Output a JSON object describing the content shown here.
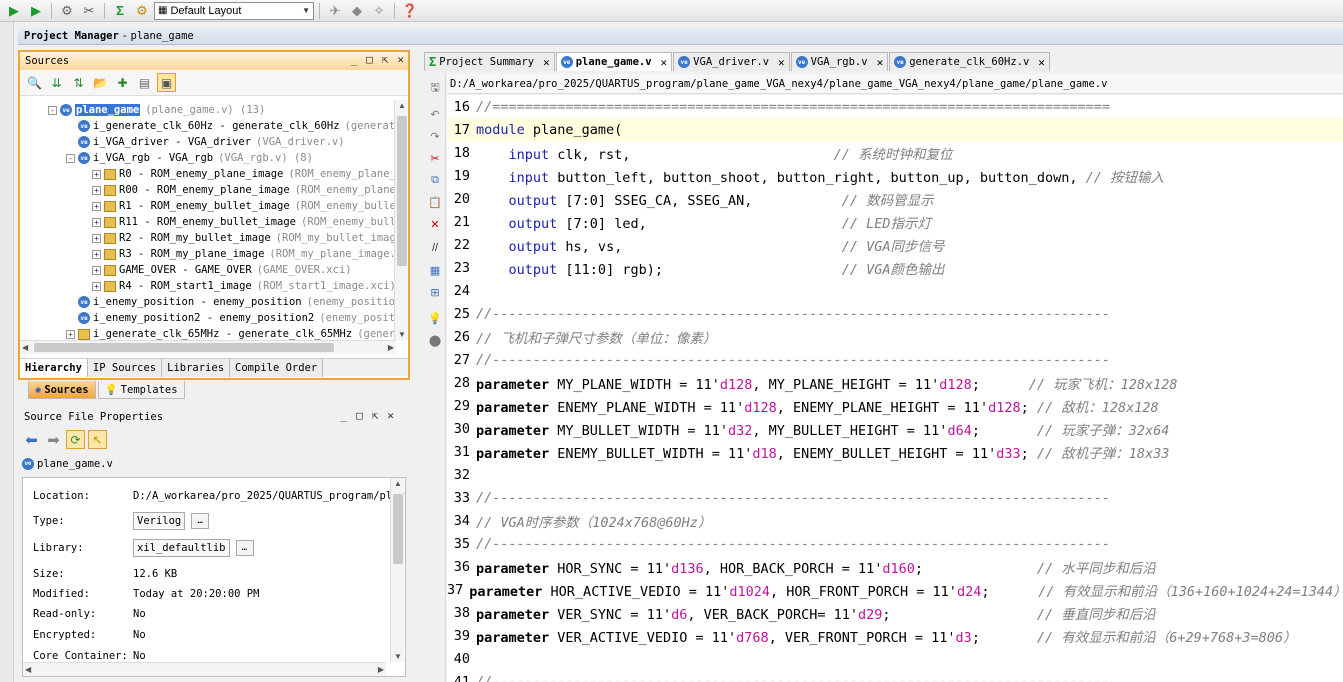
{
  "toolbar": {
    "layout_value": "Default Layout"
  },
  "project_manager": {
    "title": "Project Manager",
    "project": "plane_game"
  },
  "sources": {
    "title": "Sources",
    "tree": [
      {
        "label": "plane_game",
        "sub": "(plane_game.v) (13)",
        "icon": "verilog",
        "selected": true
      },
      {
        "label": "i_generate_clk_60Hz - generate_clk_60Hz",
        "sub": "(generate",
        "icon": "verilog"
      },
      {
        "label": "i_VGA_driver - VGA_driver",
        "sub": "(VGA_driver.v)",
        "icon": "verilog"
      },
      {
        "label": "i_VGA_rgb - VGA_rgb",
        "sub": "(VGA_rgb.v) (8)",
        "icon": "verilog"
      },
      {
        "label": "R0 - ROM_enemy_plane_image",
        "sub": "(ROM_enemy_plane_",
        "icon": "ip"
      },
      {
        "label": "R00 - ROM_enemy_plane_image",
        "sub": "(ROM_enemy_plane",
        "icon": "ip"
      },
      {
        "label": "R1 - ROM_enemy_bullet_image",
        "sub": "(ROM_enemy_bulle",
        "icon": "ip"
      },
      {
        "label": "R11 - ROM_enemy_bullet_image",
        "sub": "(ROM_enemy_bull",
        "icon": "ip"
      },
      {
        "label": "R2 - ROM_my_bullet_image",
        "sub": "(ROM_my_bullet_imag",
        "icon": "ip"
      },
      {
        "label": "R3 - ROM_my_plane_image",
        "sub": "(ROM_my_plane_image.:",
        "icon": "ip"
      },
      {
        "label": "GAME_OVER - GAME_OVER",
        "sub": "(GAME_OVER.xci)",
        "icon": "ip"
      },
      {
        "label": "R4 - ROM_start1_image",
        "sub": "(ROM_start1_image.xci)",
        "icon": "ip"
      },
      {
        "label": "i_enemy_position - enemy_position",
        "sub": "(enemy_position",
        "icon": "verilog"
      },
      {
        "label": "i_enemy_position2 - enemy_position2",
        "sub": "(enemy_positi",
        "icon": "verilog"
      },
      {
        "label": "i_generate_clk_65MHz - generate_clk_65MHz",
        "sub": "(gener",
        "icon": "ip"
      }
    ],
    "tabs": [
      "Hierarchy",
      "IP Sources",
      "Libraries",
      "Compile Order"
    ]
  },
  "bottom_tabs": [
    "Sources",
    "Templates"
  ],
  "sfp": {
    "title": "Source File Properties",
    "file": "plane_game.v",
    "props": [
      {
        "label": "Location:",
        "value": "D:/A_workarea/pro_2025/QUARTUS_program/plar"
      },
      {
        "label": "Type:",
        "value": "Verilog"
      },
      {
        "label": "Library:",
        "value": "xil_defaultlib"
      },
      {
        "label": "Size:",
        "value": "12.6 KB"
      },
      {
        "label": "Modified:",
        "value": "Today at 20:20:00 PM"
      },
      {
        "label": "Read-only:",
        "value": "No"
      },
      {
        "label": "Encrypted:",
        "value": "No"
      },
      {
        "label": "Core Container:",
        "value": "No"
      }
    ]
  },
  "editor": {
    "tabs": [
      {
        "label": "Project Summary",
        "icon": "sigma"
      },
      {
        "label": "plane_game.v",
        "icon": "verilog",
        "active": true
      },
      {
        "label": "VGA_driver.v",
        "icon": "verilog"
      },
      {
        "label": "VGA_rgb.v",
        "icon": "verilog"
      },
      {
        "label": "generate_clk_60Hz.v",
        "icon": "verilog"
      }
    ],
    "path": "D:/A_workarea/pro_2025/QUARTUS_program/plane_game_VGA_nexy4/plane_game_VGA_nexy4/plane_game/plane_game.v",
    "lines": [
      {
        "n": "16",
        "tokens": [
          [
            "cm",
            "//============================================================================"
          ]
        ]
      },
      {
        "n": "17",
        "cur": true,
        "tokens": [
          [
            "kw2",
            "module"
          ],
          [
            "t",
            " plane_game("
          ]
        ]
      },
      {
        "n": "18",
        "tokens": [
          [
            "t",
            "    "
          ],
          [
            "kw2",
            "input"
          ],
          [
            "t",
            " clk, rst,                         "
          ],
          [
            "cm",
            "// 系统时钟和复位"
          ]
        ]
      },
      {
        "n": "19",
        "tokens": [
          [
            "t",
            "    "
          ],
          [
            "kw2",
            "input"
          ],
          [
            "t",
            " button_left, button_shoot, button_right, button_up, button_down, "
          ],
          [
            "cm",
            "// 按钮输入"
          ]
        ]
      },
      {
        "n": "20",
        "tokens": [
          [
            "t",
            "    "
          ],
          [
            "kw2",
            "output"
          ],
          [
            "t",
            " [7:0] SSEG_CA, SSEG_AN,           "
          ],
          [
            "cm",
            "// 数码管显示"
          ]
        ]
      },
      {
        "n": "21",
        "tokens": [
          [
            "t",
            "    "
          ],
          [
            "kw2",
            "output"
          ],
          [
            "t",
            " [7:0] led,                        "
          ],
          [
            "cm",
            "// LED指示灯"
          ]
        ]
      },
      {
        "n": "22",
        "tokens": [
          [
            "t",
            "    "
          ],
          [
            "kw2",
            "output"
          ],
          [
            "t",
            " hs, vs,                           "
          ],
          [
            "cm",
            "// VGA同步信号"
          ]
        ]
      },
      {
        "n": "23",
        "tokens": [
          [
            "t",
            "    "
          ],
          [
            "kw2",
            "output"
          ],
          [
            "t",
            " [11:0] rgb);                      "
          ],
          [
            "cm",
            "// VGA颜色输出"
          ]
        ]
      },
      {
        "n": "24",
        "tokens": []
      },
      {
        "n": "25",
        "tokens": [
          [
            "cm",
            "//----------------------------------------------------------------------------"
          ]
        ]
      },
      {
        "n": "26",
        "tokens": [
          [
            "cm",
            "// 飞机和子弹尺寸参数（单位：像素）"
          ]
        ]
      },
      {
        "n": "27",
        "tokens": [
          [
            "cm",
            "//----------------------------------------------------------------------------"
          ]
        ]
      },
      {
        "n": "28",
        "tokens": [
          [
            "kw",
            "parameter"
          ],
          [
            "t",
            " MY_PLANE_WIDTH = 11'"
          ],
          [
            "num",
            "d128"
          ],
          [
            "t",
            ", MY_PLANE_HEIGHT = 11'"
          ],
          [
            "num",
            "d128"
          ],
          [
            "t",
            ";      "
          ],
          [
            "cm",
            "// 玩家飞机：128x128"
          ]
        ]
      },
      {
        "n": "29",
        "tokens": [
          [
            "kw",
            "parameter"
          ],
          [
            "t",
            " ENEMY_PLANE_WIDTH = 11'"
          ],
          [
            "num",
            "d128"
          ],
          [
            "t",
            ", ENEMY_PLANE_HEIGHT = 11'"
          ],
          [
            "num",
            "d128"
          ],
          [
            "t",
            "; "
          ],
          [
            "cm",
            "// 敌机：128x128"
          ]
        ]
      },
      {
        "n": "30",
        "tokens": [
          [
            "kw",
            "parameter"
          ],
          [
            "t",
            " MY_BULLET_WIDTH = 11'"
          ],
          [
            "num",
            "d32"
          ],
          [
            "t",
            ", MY_BULLET_HEIGHT = 11'"
          ],
          [
            "num",
            "d64"
          ],
          [
            "t",
            ";       "
          ],
          [
            "cm",
            "// 玩家子弹：32x64"
          ]
        ]
      },
      {
        "n": "31",
        "tokens": [
          [
            "kw",
            "parameter"
          ],
          [
            "t",
            " ENEMY_BULLET_WIDTH = 11'"
          ],
          [
            "num",
            "d18"
          ],
          [
            "t",
            ", ENEMY_BULLET_HEIGHT = 11'"
          ],
          [
            "num",
            "d33"
          ],
          [
            "t",
            "; "
          ],
          [
            "cm",
            "// 敌机子弹：18x33"
          ]
        ]
      },
      {
        "n": "32",
        "tokens": []
      },
      {
        "n": "33",
        "tokens": [
          [
            "cm",
            "//----------------------------------------------------------------------------"
          ]
        ]
      },
      {
        "n": "34",
        "tokens": [
          [
            "cm",
            "// VGA时序参数（1024x768@60Hz）"
          ]
        ]
      },
      {
        "n": "35",
        "tokens": [
          [
            "cm",
            "//----------------------------------------------------------------------------"
          ]
        ]
      },
      {
        "n": "36",
        "tokens": [
          [
            "kw",
            "parameter"
          ],
          [
            "t",
            " HOR_SYNC = 11'"
          ],
          [
            "num",
            "d136"
          ],
          [
            "t",
            ", HOR_BACK_PORCH = 11'"
          ],
          [
            "num",
            "d160"
          ],
          [
            "t",
            ";              "
          ],
          [
            "cm",
            "// 水平同步和后沿"
          ]
        ]
      },
      {
        "n": "37",
        "tokens": [
          [
            "kw",
            "parameter"
          ],
          [
            "t",
            " HOR_ACTIVE_VEDIO = 11'"
          ],
          [
            "num",
            "d1024"
          ],
          [
            "t",
            ", HOR_FRONT_PORCH = 11'"
          ],
          [
            "num",
            "d24"
          ],
          [
            "t",
            ";      "
          ],
          [
            "cm",
            "// 有效显示和前沿（136+160+1024+24=1344）"
          ]
        ]
      },
      {
        "n": "38",
        "tokens": [
          [
            "kw",
            "parameter"
          ],
          [
            "t",
            " VER_SYNC = 11'"
          ],
          [
            "num",
            "d6"
          ],
          [
            "t",
            ", VER_BACK_PORCH= 11'"
          ],
          [
            "num",
            "d29"
          ],
          [
            "t",
            ";                  "
          ],
          [
            "cm",
            "// 垂直同步和后沿"
          ]
        ]
      },
      {
        "n": "39",
        "tokens": [
          [
            "kw",
            "parameter"
          ],
          [
            "t",
            " VER_ACTIVE_VEDIO = 11'"
          ],
          [
            "num",
            "d768"
          ],
          [
            "t",
            ", VER_FRONT_PORCH = 11'"
          ],
          [
            "num",
            "d3"
          ],
          [
            "t",
            ";       "
          ],
          [
            "cm",
            "// 有效显示和前沿（6+29+768+3=806）"
          ]
        ]
      },
      {
        "n": "40",
        "tokens": []
      },
      {
        "n": "41",
        "tokens": [
          [
            "cm",
            "//----------------------------------------------------------------------------"
          ]
        ]
      }
    ]
  }
}
